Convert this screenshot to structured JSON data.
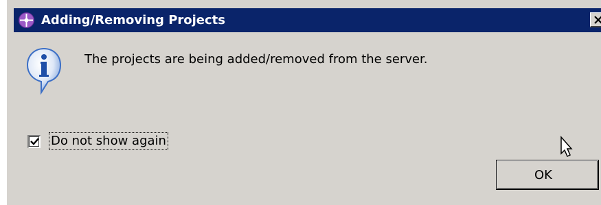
{
  "window": {
    "title": "Adding/Removing Projects",
    "title_icon": "eclipse-server-icon",
    "close_label": "close"
  },
  "dialog": {
    "icon": "info-icon",
    "message": "The projects are being added/removed from the server.",
    "checkbox": {
      "label": "Do not show again",
      "checked": true
    },
    "ok_label": "OK"
  },
  "colors": {
    "titlebar": "#0a246a",
    "face": "#d6d3ce",
    "info_icon": "#3c6fc6"
  }
}
